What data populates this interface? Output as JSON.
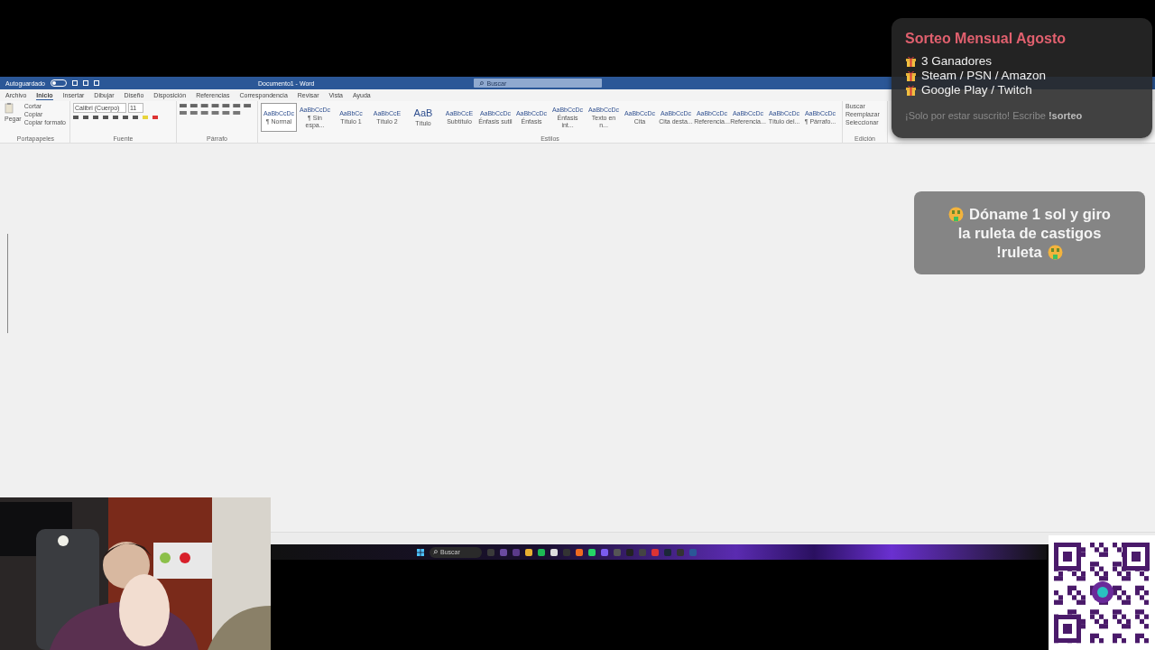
{
  "word": {
    "title_bar": {
      "autosave_label": "Autoguardado",
      "autosave": {
        "on": false
      },
      "title": "Documento1 - Word",
      "search": {
        "placeholder": "Buscar"
      }
    },
    "tabs": [
      {
        "label": "Archivo",
        "selected": false
      },
      {
        "label": "Inicio",
        "selected": true
      },
      {
        "label": "Insertar",
        "selected": false
      },
      {
        "label": "Dibujar",
        "selected": false
      },
      {
        "label": "Diseño",
        "selected": false
      },
      {
        "label": "Disposición",
        "selected": false
      },
      {
        "label": "Referencias",
        "selected": false
      },
      {
        "label": "Correspondencia",
        "selected": false
      },
      {
        "label": "Revisar",
        "selected": false
      },
      {
        "label": "Vista",
        "selected": false
      },
      {
        "label": "Ayuda",
        "selected": false
      }
    ],
    "clipboard": {
      "paste": "Pegar",
      "cut": "Cortar",
      "copy": "Copiar",
      "format_painter": "Copiar formato",
      "group": "Portapapeles"
    },
    "font": {
      "name": "Calibri (Cuerpo)",
      "size": "11",
      "group": "Fuente"
    },
    "paragraph": {
      "group": "Párrafo"
    },
    "styles": {
      "group": "Estilos",
      "items": [
        {
          "preview": "AaBbCcDc",
          "label": "¶ Normal",
          "selected": true
        },
        {
          "preview": "AaBbCcDc",
          "label": "¶ Sin espa...",
          "selected": false
        },
        {
          "preview": "AaBbCc",
          "label": "Título 1",
          "selected": false
        },
        {
          "preview": "AaBbCcE",
          "label": "Título 2",
          "selected": false
        },
        {
          "preview": "AaB",
          "label": "Título",
          "selected": false
        },
        {
          "preview": "AaBbCcE",
          "label": "Subtítulo",
          "selected": false
        },
        {
          "preview": "AaBbCcDc",
          "label": "Énfasis sutil",
          "selected": false
        },
        {
          "preview": "AaBbCcDc",
          "label": "Énfasis",
          "selected": false
        },
        {
          "preview": "AaBbCcDc",
          "label": "Énfasis int...",
          "selected": false
        },
        {
          "preview": "AaBbCcDc",
          "label": "Texto en n...",
          "selected": false
        },
        {
          "preview": "AaBbCcDc",
          "label": "Cita",
          "selected": false
        },
        {
          "preview": "AaBbCcDc",
          "label": "Cita desta...",
          "selected": false
        },
        {
          "preview": "AaBbCcDc",
          "label": "Referencia...",
          "selected": false
        },
        {
          "preview": "AaBbCcDc",
          "label": "Referencia...",
          "selected": false
        },
        {
          "preview": "AaBbCcDc",
          "label": "Título del...",
          "selected": false
        },
        {
          "preview": "AaBbCcDc",
          "label": "¶ Párrafo...",
          "selected": false
        }
      ]
    },
    "editing": {
      "group": "Edición",
      "items": [
        "Buscar",
        "Reemplazar",
        "Seleccionar"
      ]
    }
  },
  "taskbar": {
    "search": {
      "placeholder": "Buscar"
    }
  },
  "giveaway": {
    "title": "Sorteo Mensual Agosto",
    "items": [
      "3 Ganadores",
      "Steam / PSN / Amazon",
      "Google Play / Twitch"
    ],
    "footer": "¡Solo por estar suscrito! Escribe **!sorteo**"
  },
  "donation": {
    "lines": [
      "Dóname 1 sol y giro",
      "la ruleta de castigos",
      "!ruleta"
    ]
  }
}
